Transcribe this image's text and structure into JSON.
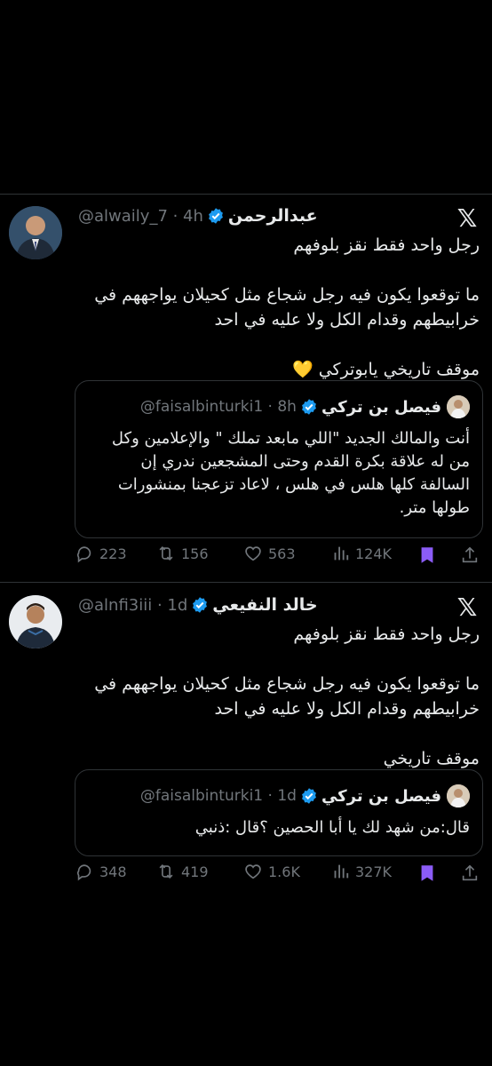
{
  "tweets": [
    {
      "name": "عبدالرحمن",
      "handle": "@alwaily_7 · 4h",
      "body": "رجل واحد فقط نقز بلوفهم\n\nما توقعوا يكون فيه رجل شجاع مثل كحيلان يواجههم في خرابيطهم وقدام الكل ولا عليه في احد\n\nموقف تاريخي يابوتركي 💛",
      "quote": {
        "name": "فيصل بن تركي",
        "handle": "@faisalbinturki1 · 8h",
        "text": "أنت والمالك الجديد \"اللي مابعد تملك \" والإعلامين وكل من له علاقة بكرة القدم وحتى المشجعين ندري إن السالفة كلها هلس في هلس ، لاعاد تزعجنا بمنشورات طولها متر."
      },
      "stats": {
        "replies": "223",
        "retweets": "156",
        "likes": "563",
        "views": "124K"
      }
    },
    {
      "name": "خالد النفيعي",
      "handle": "@alnfi3iii · 1d",
      "body": "رجل واحد فقط نقز بلوفهم\n\nما توقعوا يكون فيه رجل شجاع مثل كحيلان يواجههم في خرابيطهم وقدام الكل ولا عليه في احد\n\nموقف تاريخي",
      "quote": {
        "name": "فيصل بن تركي",
        "handle": "@faisalbinturki1 · 1d",
        "text": "قال:من شهد لك يا أبا الحصين ؟قال :ذنبي"
      },
      "stats": {
        "replies": "348",
        "retweets": "419",
        "likes": "1.6K",
        "views": "327K"
      }
    }
  ],
  "icons": {
    "reply": "reply-icon",
    "retweet": "retweet-icon",
    "like": "heart-icon",
    "views": "views-icon",
    "bookmark": "bookmark-icon",
    "share": "share-icon",
    "x": "x-logo-icon"
  },
  "colors": {
    "verified": "#1d9bf0",
    "bookmark": "#8b5cf6",
    "muted": "#71767b"
  }
}
